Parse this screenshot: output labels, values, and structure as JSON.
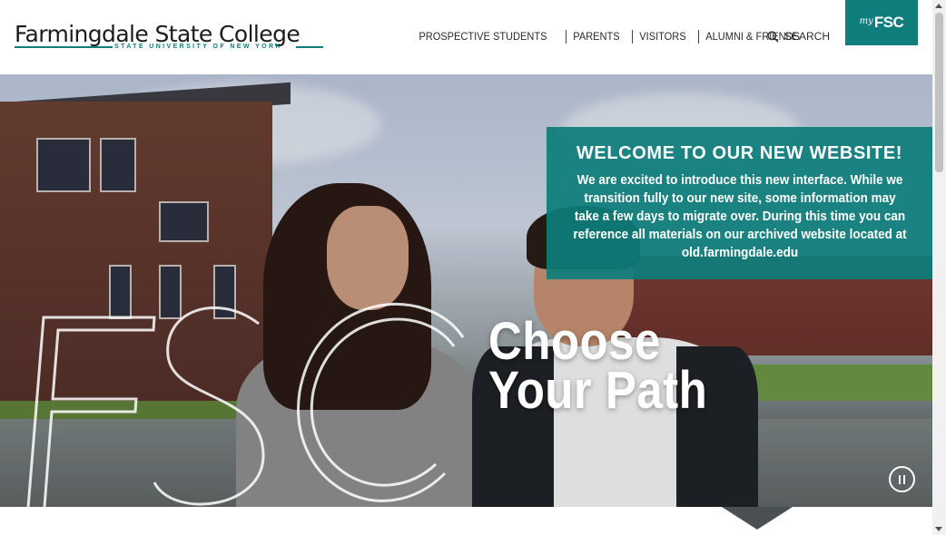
{
  "header": {
    "logo": {
      "name": "Farmingdale State College",
      "subtitle": "STATE UNIVERSITY OF NEW YORK"
    },
    "nav": [
      {
        "label": "PROSPECTIVE STUDENTS"
      },
      {
        "label": "PARENTS"
      },
      {
        "label": "VISITORS"
      },
      {
        "label": "ALUMNI & FRIENDS"
      }
    ],
    "search": {
      "label": "SEARCH",
      "icon": "search-icon"
    },
    "myfsc": {
      "my": "my",
      "fsc": "FSC"
    }
  },
  "hero": {
    "headline_line1": "Choose",
    "headline_line2": "Your Path",
    "pause_icon": "pause-icon"
  },
  "welcome": {
    "title": "WELCOME TO OUR NEW WEBSITE!",
    "body": "We are excited to introduce this new interface. While we transition fully to our new site, some information may take a few days to migrate over. During this time you can reference all materials on our archived website located at old.farmingdale.edu"
  },
  "colors": {
    "brand_teal": "#0e7d7b",
    "text_dark": "#2a2a2a"
  }
}
